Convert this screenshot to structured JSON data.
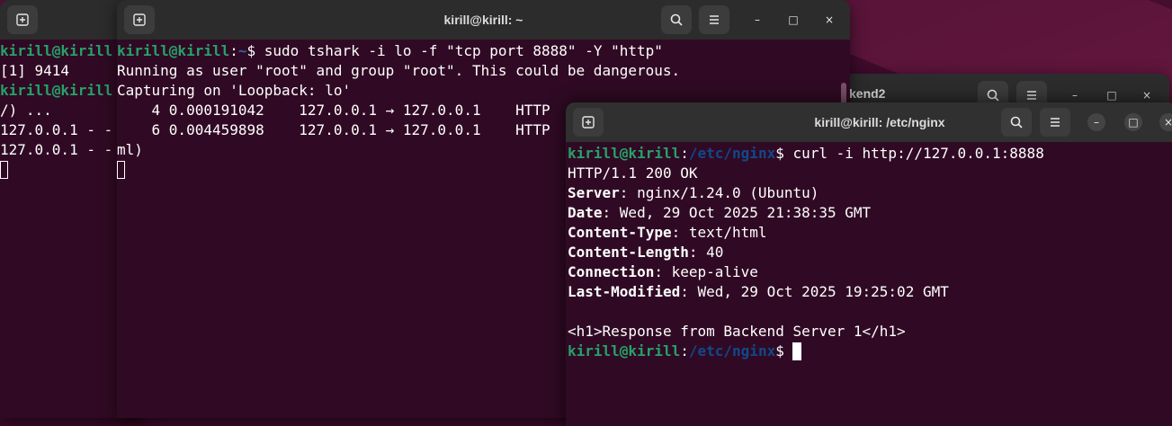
{
  "left_term": {
    "lines": [
      {
        "user": "kirill@kirill",
        "rest": ""
      },
      {
        "text": "[1] 9414"
      },
      {
        "user": "kirill@kirill",
        "rest": ""
      },
      {
        "text": "/) ..."
      },
      {
        "text": "127.0.0.1 - -"
      },
      {
        "text": "127.0.0.1 - -"
      }
    ]
  },
  "mid_term": {
    "title": "kirill@kirill: ~",
    "prompt_user": "kirill@kirill",
    "prompt_path": "~",
    "command": "$ sudo tshark -i lo -f \"tcp port 8888\" -Y \"http\"",
    "lines": [
      "Running as user \"root\" and group \"root\". This could be dangerous.",
      "Capturing on 'Loopback: lo'",
      "    4 0.000191042    127.0.0.1 → 127.0.0.1    HTTP",
      "    6 0.004459898    127.0.0.1 → 127.0.0.1    HTTP",
      "ml)"
    ]
  },
  "back_term": {
    "title": "kend2"
  },
  "front_term": {
    "title": "kirill@kirill: /etc/nginx",
    "prompt_user": "kirill@kirill",
    "prompt_path": "/etc/nginx",
    "command": "$ curl -i http://127.0.0.1:8888",
    "status": "HTTP/1.1 200 OK",
    "headers": [
      {
        "key": "Server",
        "value": ": nginx/1.24.0 (Ubuntu)"
      },
      {
        "key": "Date",
        "value": ": Wed, 29 Oct 2025 21:38:35 GMT"
      },
      {
        "key": "Content-Type",
        "value": ": text/html"
      },
      {
        "key": "Content-Length",
        "value": ": 40"
      },
      {
        "key": "Connection",
        "value": ": keep-alive"
      },
      {
        "key": "Last-Modified",
        "value": ": Wed, 29 Oct 2025 19:25:02 GMT"
      }
    ],
    "body": "<h1>Response from Backend Server 1</h1>",
    "prompt_end": "$ "
  },
  "colors": {
    "terminal_bg": "#300a24",
    "titlebar_bg": "#2c2c2c",
    "prompt_user": "#26a269",
    "prompt_path": "#12488b"
  },
  "icons": [
    "new-tab-icon",
    "search-icon",
    "menu-icon",
    "minimize-icon",
    "maximize-icon",
    "close-icon"
  ],
  "controls": {
    "minimize": "–",
    "maximize": "□",
    "close": "×"
  }
}
